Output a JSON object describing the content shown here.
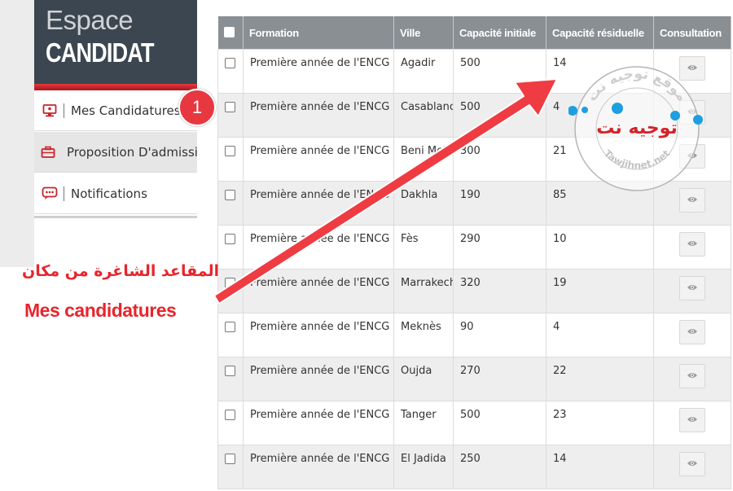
{
  "sidebar": {
    "header_line1": "Espace",
    "header_line2": "CANDIDAT",
    "items": [
      {
        "label": "Mes Candidatures",
        "icon": "monitor-icon"
      },
      {
        "label": "Proposition D'admission",
        "icon": "briefcase-icon"
      },
      {
        "label": "Notifications",
        "icon": "chat-icon"
      }
    ]
  },
  "table": {
    "headers": [
      "Formation",
      "Ville",
      "Capacité initiale",
      "Capacité résiduelle",
      "Consultation"
    ],
    "rows": [
      {
        "formation": "Première année de l'ENCG",
        "ville": "Agadir",
        "initiale": "500",
        "residuelle": "14"
      },
      {
        "formation": "Première année de l'ENCG",
        "ville": "Casablanca",
        "initiale": "500",
        "residuelle": "4"
      },
      {
        "formation": "Première année de l'ENCG",
        "ville": "Beni Mellal",
        "initiale": "300",
        "residuelle": "21"
      },
      {
        "formation": "Première année de l'ENCG",
        "ville": "Dakhla",
        "initiale": "190",
        "residuelle": "85"
      },
      {
        "formation": "Première année de l'ENCG",
        "ville": "Fès",
        "initiale": "290",
        "residuelle": "10"
      },
      {
        "formation": "Première année de l'ENCG",
        "ville": "Marrakech",
        "initiale": "320",
        "residuelle": "19"
      },
      {
        "formation": "Première année de l'ENCG",
        "ville": "Meknès",
        "initiale": "90",
        "residuelle": "4"
      },
      {
        "formation": "Première année de l'ENCG",
        "ville": "Oujda",
        "initiale": "270",
        "residuelle": "22"
      },
      {
        "formation": "Première année de l'ENCG",
        "ville": "Tanger",
        "initiale": "500",
        "residuelle": "23"
      },
      {
        "formation": "Première année de l'ENCG",
        "ville": "El Jadida",
        "initiale": "250",
        "residuelle": "14"
      }
    ]
  },
  "annotation": {
    "badge": "1",
    "note_arabic": "المقاعد الشاغرة من مكان",
    "note_latin": "Mes candidatures",
    "accent": "#e8383f"
  },
  "watermark": {
    "name": "توجيه نت",
    "arc_top": "موقع توجيه نت",
    "arc_bottom": "Tawjihnet.net"
  },
  "colors": {
    "header_bg": "#3b4650",
    "table_header": "#8a8f94",
    "row_alt": "#eeeeee"
  }
}
